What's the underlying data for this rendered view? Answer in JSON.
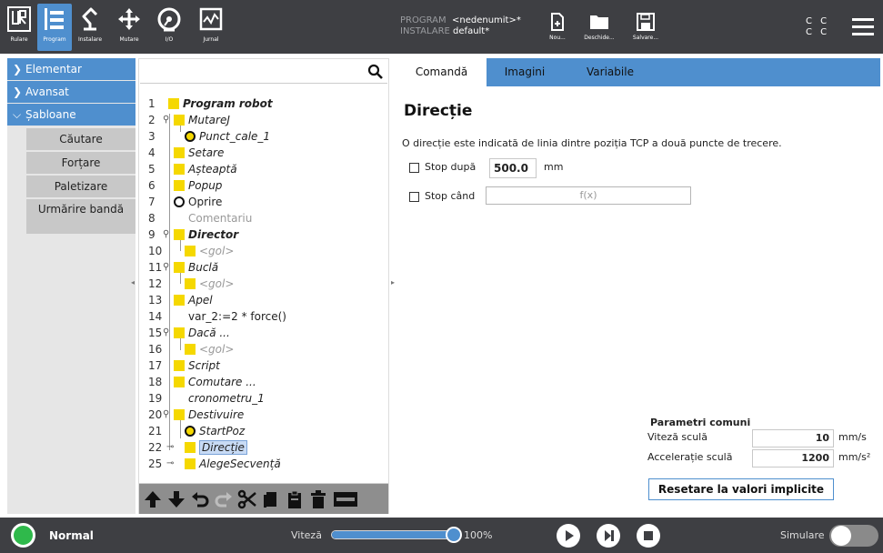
{
  "colors": {
    "accent": "#4f8fce",
    "topbar": "#3e3f43",
    "power_on": "#2fb94b",
    "node_icon": "#f5d800"
  },
  "nav": {
    "run": "Rulare",
    "program": "Program",
    "install": "Instalare",
    "move": "Mutare",
    "io": "I/O",
    "log": "Jurnal"
  },
  "program_info": {
    "program_key": "PROGRAM",
    "program_value": "<nedenumit>*",
    "install_key": "INSTALARE",
    "install_value": "default*"
  },
  "file": {
    "new": "Nou...",
    "open": "Deschide...",
    "save": "Salvare..."
  },
  "cc": [
    "C C",
    "C C"
  ],
  "categories": {
    "basic": "Elementar",
    "advanced": "Avansat",
    "templates": "Șabloane",
    "template_items": [
      "Căutare",
      "Forțare",
      "Paletizare",
      "Urmărire bandă"
    ]
  },
  "tree": [
    {
      "num": "1",
      "label": "Program robot"
    },
    {
      "num": "2",
      "label": "MutareJ"
    },
    {
      "num": "3",
      "label": "Punct_cale_1"
    },
    {
      "num": "4",
      "label": "Setare"
    },
    {
      "num": "5",
      "label": "Așteaptă"
    },
    {
      "num": "6",
      "label": "Popup"
    },
    {
      "num": "7",
      "label": "Oprire"
    },
    {
      "num": "8",
      "label": "Comentariu"
    },
    {
      "num": "9",
      "label": "Director"
    },
    {
      "num": "10",
      "label": "<gol>"
    },
    {
      "num": "11",
      "label": "Buclă"
    },
    {
      "num": "12",
      "label": "<gol>"
    },
    {
      "num": "13",
      "label": "Apel"
    },
    {
      "num": "14",
      "label": "var_2:=2 * force()"
    },
    {
      "num": "15",
      "label": "Dacă ..."
    },
    {
      "num": "16",
      "label": "<gol>"
    },
    {
      "num": "17",
      "label": "Script"
    },
    {
      "num": "18",
      "label": "Comutare ..."
    },
    {
      "num": "19",
      "label": "cronometru_1"
    },
    {
      "num": "20",
      "label": "Destivuire"
    },
    {
      "num": "21",
      "label": "StartPoz"
    },
    {
      "num": "22",
      "label": "Direcție"
    },
    {
      "num": "25",
      "label": "AlegeSecvență"
    }
  ],
  "tabs": {
    "command": "Comandă",
    "images": "Imagini",
    "variables": "Variabile"
  },
  "command": {
    "title": "Direcție",
    "description": "O direcție este indicată de linia dintre poziția TCP a două puncte de trecere.",
    "stop_after_label": "Stop după",
    "stop_after_value": "500.0",
    "stop_after_unit": "mm",
    "stop_when_label": "Stop când",
    "expr_placeholder": "f(x)"
  },
  "common_params": {
    "title": "Parametri comuni",
    "tool_speed_label": "Viteză sculă",
    "tool_speed_value": "10",
    "tool_speed_unit": "mm/s",
    "tool_accel_label": "Accelerație sculă",
    "tool_accel_value": "1200",
    "tool_accel_unit": "mm/s²",
    "reset_label": "Resetare la valori implicite"
  },
  "bottom": {
    "status": "Normal",
    "speed_label": "Viteză",
    "speed_value": "100%",
    "speed_fraction": 1.0,
    "sim_label": "Simulare"
  }
}
